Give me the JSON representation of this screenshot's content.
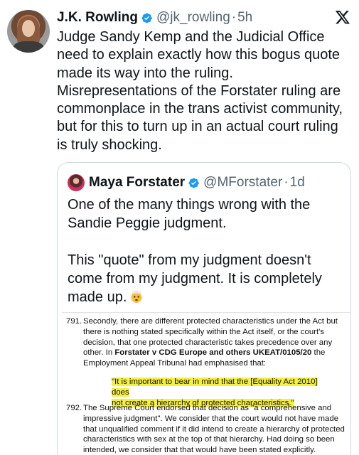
{
  "author": {
    "name": "J.K. Rowling",
    "handle": "@jk_rowling",
    "separator": "·",
    "time": "5h",
    "avatar_icon": "avatar"
  },
  "tweet_text": "Judge Sandy Kemp and the Judicial Office\nneed to explain exactly how this bogus quote\nmade its way into the ruling.\nMisrepresentations of the Forstater ruling are\ncommonplace in the trans activist community,\nbut for this to turn up in an actual court ruling\nis truly shocking.",
  "quoted": {
    "name": "Maya Forstater",
    "handle": "@MForstater",
    "separator": "·",
    "time": "1d",
    "text": "One of the many things wrong with the\nSandie Peggie judgment.\n\nThis \"quote\" from my judgment doesn't\ncome from my judgment. It is completely\nmade up.",
    "emoji_icon": "exploding-head-icon",
    "document": {
      "p791_num": "791.",
      "p791_text_a": "Secondly, there are different protected characteristics under the Act but\nthere is nothing stated specifically within the Act itself, or the court's\ndecision, that one protected characteristic takes precedence over any\nother. In ",
      "p791_case": "Forstater v CDG Europe and others UKEAT/0105/20",
      "p791_text_b": " the\nEmployment Appeal Tribunal had emphasised that:",
      "highlight": "\"It is important to bear in mind that the [Equality Act 2010] does\nnot  create a hierarchy of protected characteristics.\"",
      "p792_num": "792.",
      "p792_text": "The Supreme Court endorsed that decision as \"a comprehensive and\nimpressive judgment\". We consider that the court would not have made\nthat unqualified comment if it did intend to create a hierarchy of protected\ncharacteristics with sex at the top of that hierarchy. Had doing so been\nintended, we consider that that would have been stated explicitly."
    }
  },
  "colors": {
    "verified": "#1d9bf0",
    "secondary_text": "#536471",
    "highlight": "#f5f03f"
  },
  "icons": [
    "verified-badge-icon",
    "x-logo-icon"
  ]
}
